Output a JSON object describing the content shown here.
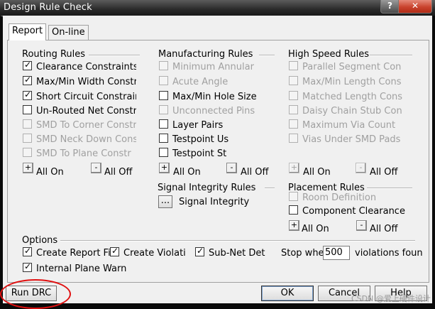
{
  "window": {
    "title": "Design Rule Check",
    "help_glyph": "?",
    "close_glyph": "✕"
  },
  "tabs": [
    {
      "label": "Report"
    },
    {
      "label": "On-line"
    }
  ],
  "routing": {
    "label": "Routing Rules",
    "items": [
      "Clearance Constraints",
      "Max/Min Width Constr",
      "Short Circuit Constrain",
      "Un-Routed Net Constr",
      "SMD To Corner Constr",
      "SMD Neck Down Cons",
      "SMD To Plane Constr"
    ],
    "all_on": "All On",
    "all_off": "All Off"
  },
  "manufacturing": {
    "label": "Manufacturing Rules",
    "items": [
      "Minimum Annular",
      "Acute Angle",
      "Max/Min Hole Size",
      "Unconnected Pins",
      "Layer Pairs",
      "Testpoint Us",
      "Testpoint St"
    ],
    "all_on": "All On",
    "all_off": "All Off"
  },
  "highspeed": {
    "label": "High Speed Rules",
    "items": [
      "Parallel Segment Con",
      "Max/Min Length Cons",
      "Matched Length Cons",
      "Daisy Chain Stub Con",
      "Maximum Via Count",
      "Vias Under SMD Pads"
    ],
    "all_on": "All On",
    "all_off": "All Off"
  },
  "signal": {
    "label": "Signal Integrity Rules",
    "button": "...",
    "text": "Signal Integrity"
  },
  "placement": {
    "label": "Placement Rules",
    "items": [
      "Room Definition",
      "Component Clearance"
    ],
    "all_on": "All On",
    "all_off": "All Off"
  },
  "options": {
    "label": "Options",
    "create_report": "Create Report Fi",
    "create_violations": "Create Violati",
    "subnet": "Sub-Net Det",
    "stop_label": "Stop whe",
    "stop_value": "500",
    "violations": "violations foun",
    "internal_plane": "Internal Plane Warn"
  },
  "buttons": {
    "run": "Run DRC",
    "ok": "OK",
    "cancel": "Cancel",
    "help": "Help"
  },
  "watermark": "CSDN @爱上硬件设计",
  "small_plus": "+",
  "small_minus": "-",
  "check_glyph": "✓"
}
